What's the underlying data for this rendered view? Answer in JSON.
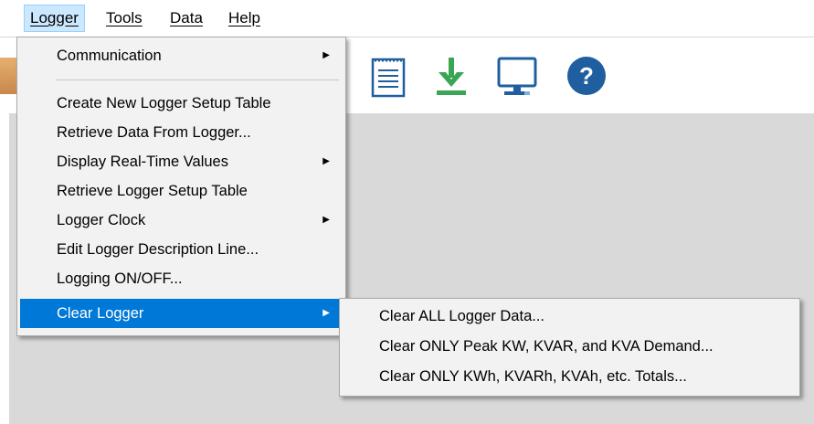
{
  "menubar": {
    "items": [
      {
        "label": "Logger"
      },
      {
        "label": "Tools"
      },
      {
        "label": "Data"
      },
      {
        "label": "Help"
      }
    ]
  },
  "toolbar": {
    "icons": [
      "notepad-icon",
      "download-icon",
      "monitor-icon",
      "help-icon"
    ],
    "help_glyph": "?"
  },
  "logger_menu": {
    "items": [
      {
        "label": "Communication",
        "submenu": true
      },
      {
        "label": "Create New Logger Setup Table",
        "submenu": false
      },
      {
        "label": "Retrieve Data From Logger...",
        "submenu": false
      },
      {
        "label": "Display Real-Time Values",
        "submenu": true
      },
      {
        "label": "Retrieve Logger Setup Table",
        "submenu": false
      },
      {
        "label": "Logger Clock",
        "submenu": true
      },
      {
        "label": "Edit Logger Description Line...",
        "submenu": false
      },
      {
        "label": "Logging ON/OFF...",
        "submenu": false
      },
      {
        "label": "Clear Logger",
        "submenu": true,
        "selected": true
      }
    ]
  },
  "clear_logger_submenu": {
    "items": [
      {
        "label": "Clear ALL Logger Data..."
      },
      {
        "label": "Clear ONLY Peak KW, KVAR, and KVA Demand..."
      },
      {
        "label": "Clear ONLY KWh, KVARh, KVAh, etc. Totals..."
      }
    ]
  },
  "colors": {
    "selection": "#0078d7",
    "download_green": "#3aa655",
    "monitor_blue": "#1f5fa0",
    "help_blue": "#1f5fa0",
    "workspace_gray": "#d9d9d9"
  }
}
